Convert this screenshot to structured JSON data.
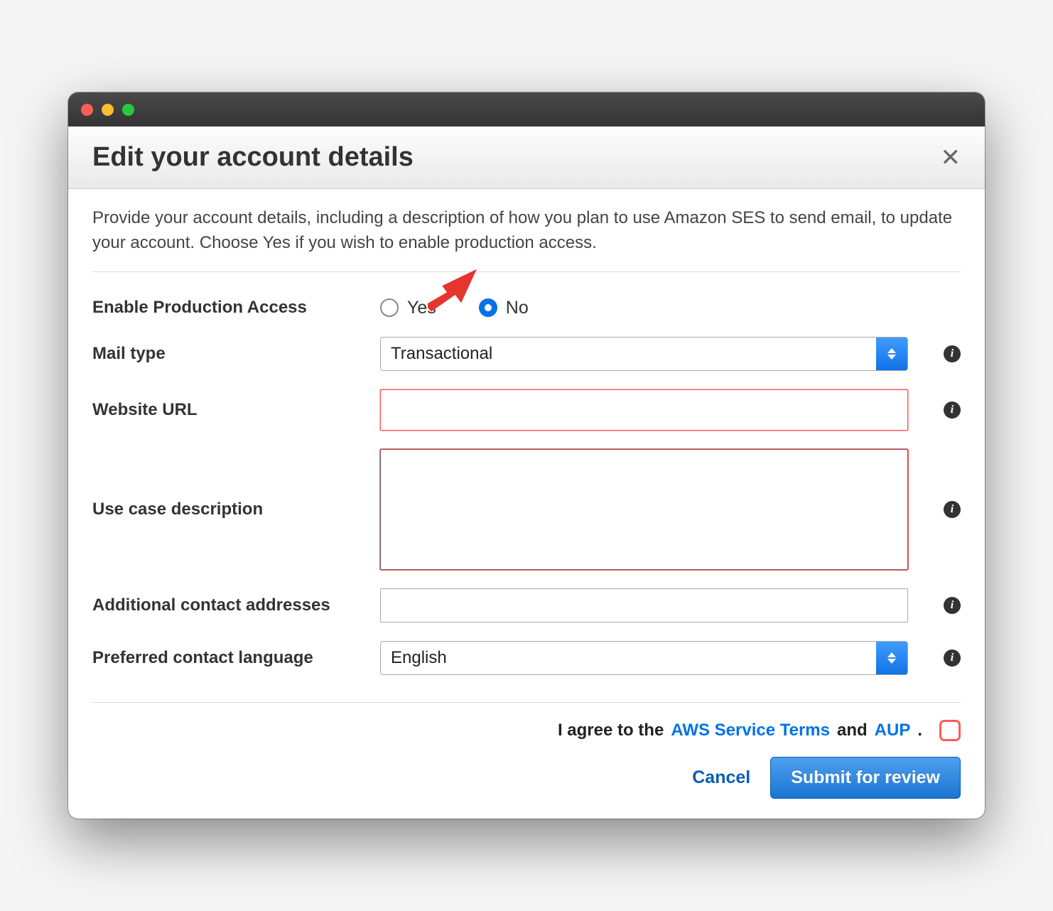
{
  "dialog": {
    "title": "Edit your account details",
    "intro": "Provide your account details, including a description of how you plan to use Amazon SES to send email, to update your account. Choose Yes if you wish to enable production access."
  },
  "fields": {
    "production_access": {
      "label": "Enable Production Access",
      "option_yes": "Yes",
      "option_no": "No",
      "selected": "No"
    },
    "mail_type": {
      "label": "Mail type",
      "value": "Transactional"
    },
    "website_url": {
      "label": "Website URL",
      "value": ""
    },
    "use_case": {
      "label": "Use case description",
      "value": ""
    },
    "additional_contacts": {
      "label": "Additional contact addresses",
      "value": ""
    },
    "language": {
      "label": "Preferred contact language",
      "value": "English"
    }
  },
  "footer": {
    "agree_prefix": "I agree to the",
    "terms_link": "AWS Service Terms",
    "and": "and",
    "aup_link": "AUP",
    "period": ".",
    "cancel": "Cancel",
    "submit": "Submit for review"
  }
}
